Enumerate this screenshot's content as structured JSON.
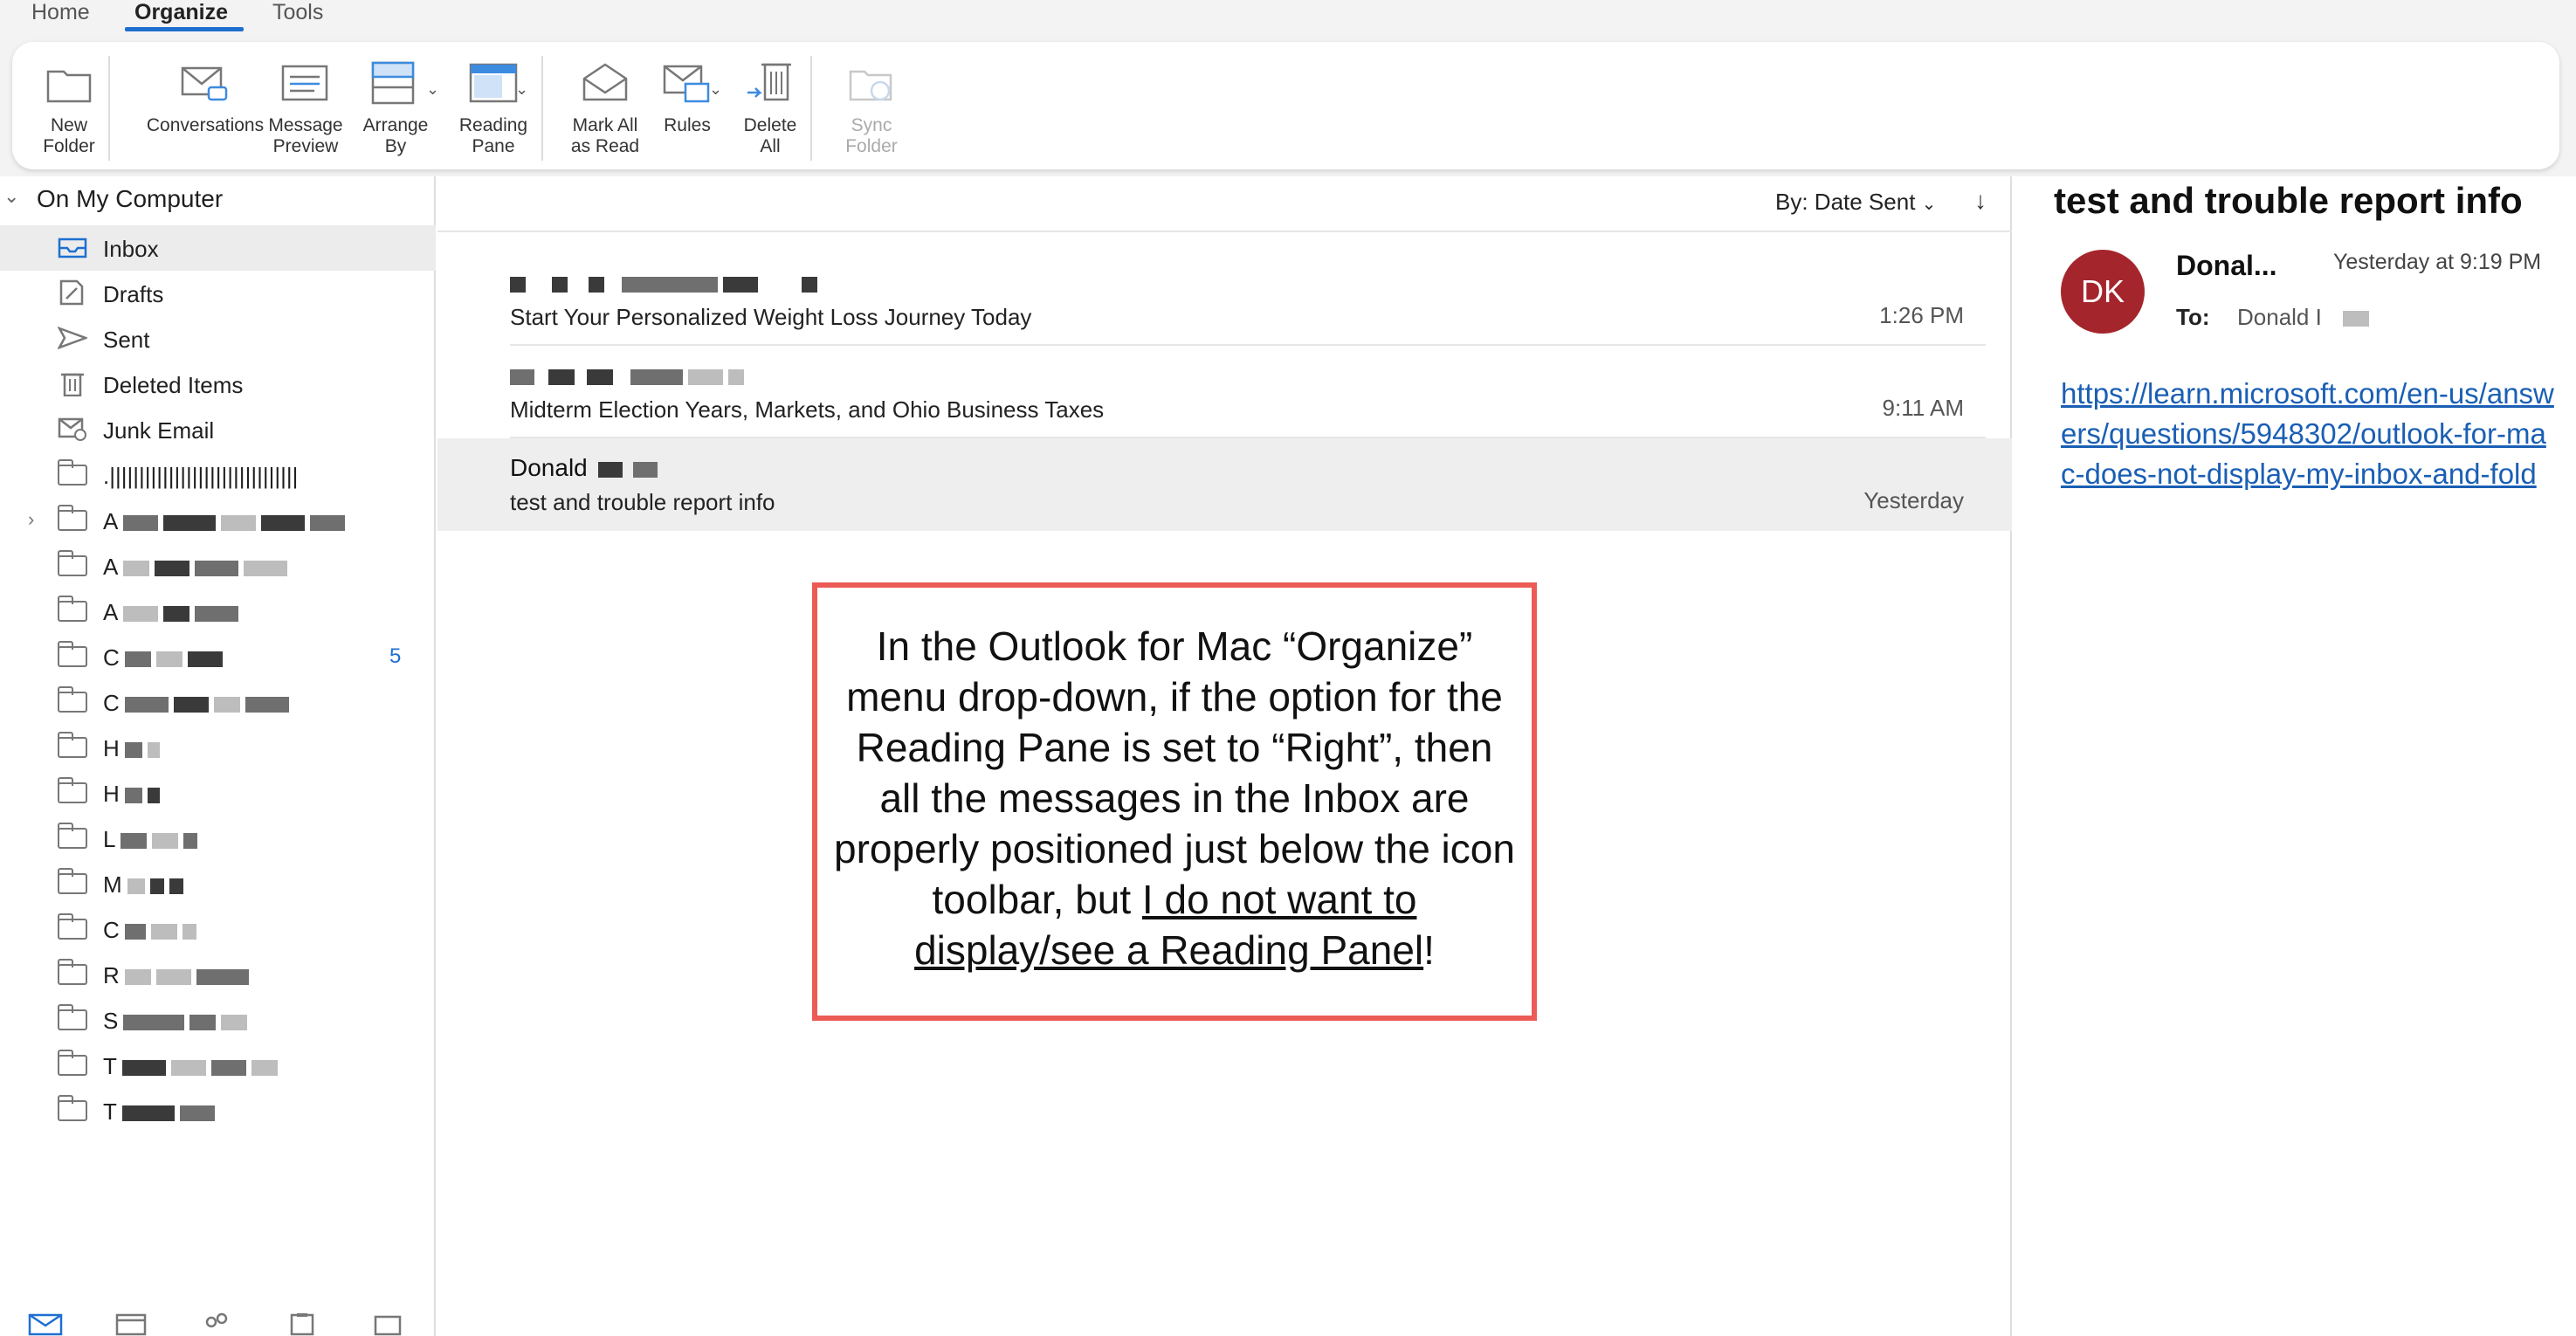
{
  "tabs": [
    {
      "label": "Home"
    },
    {
      "label": "Organize",
      "active": true
    },
    {
      "label": "Tools"
    }
  ],
  "ribbon": {
    "new_folder": "New\nFolder",
    "conversations": "Conversations",
    "message_preview": "Message\nPreview",
    "arrange_by": "Arrange\nBy",
    "reading_pane": "Reading\nPane",
    "mark_all_read": "Mark All\nas Read",
    "rules": "Rules",
    "delete_all": "Delete\nAll",
    "sync_folder": "Sync\nFolder"
  },
  "sidebar": {
    "account": "On My Computer",
    "folders": [
      {
        "label": "Inbox",
        "icon": "inbox-icon"
      },
      {
        "label": "Drafts",
        "icon": "drafts-icon"
      },
      {
        "label": "Sent",
        "icon": "sent-icon"
      },
      {
        "label": "Deleted Items",
        "icon": "trash-icon"
      },
      {
        "label": "Junk Email",
        "icon": "junk-icon"
      },
      {
        "label": ".||||||||||||||||||||||||||||||||",
        "icon": "folder-icon"
      },
      {
        "label": "A",
        "icon": "folder-icon"
      },
      {
        "label": "A",
        "icon": "folder-icon"
      },
      {
        "label": "A",
        "icon": "folder-icon"
      },
      {
        "label": "C",
        "icon": "folder-icon",
        "badge": "5"
      },
      {
        "label": "C",
        "icon": "folder-icon"
      },
      {
        "label": "H",
        "icon": "folder-icon"
      },
      {
        "label": "H",
        "icon": "folder-icon"
      },
      {
        "label": "L",
        "icon": "folder-icon"
      },
      {
        "label": "M",
        "icon": "folder-icon"
      },
      {
        "label": "C",
        "icon": "folder-icon"
      },
      {
        "label": "R",
        "icon": "folder-icon"
      },
      {
        "label": "S",
        "icon": "folder-icon"
      },
      {
        "label": "T",
        "icon": "folder-icon"
      },
      {
        "label": "T",
        "icon": "folder-icon"
      }
    ]
  },
  "list": {
    "sort_label": "By: Date Sent",
    "sort_arrow": "↓",
    "messages": [
      {
        "sender": "",
        "subject": "Start Your Personalized Weight Loss Journey Today",
        "time": "1:26 PM"
      },
      {
        "sender": "",
        "subject": "Midterm Election Years, Markets, and Ohio Business Taxes",
        "time": "9:11 AM"
      },
      {
        "sender": "Donald",
        "subject": "test and trouble report info",
        "time": "Yesterday"
      }
    ]
  },
  "callout": {
    "line1": "In the Outlook for Mac “Organize” menu drop-down, if the option for the Reading Pane is set to “Right”, then all the messages in the Inbox are properly positioned just below the icon toolbar, but ",
    "underlined": "I do not want to display/see a Reading Panel",
    "end": "!"
  },
  "reading": {
    "title": "test and trouble report info",
    "avatar_initials": "DK",
    "sender": "Donal...",
    "time": "Yesterday at 9:19 PM",
    "to_label": "To:",
    "to_name": "Donald I",
    "link": "https://learn.microsoft.com/en-us/answers/questions/5948302/outlook-for-mac-does-not-display-my-inbox-and-fold"
  },
  "colors": {
    "accent": "#1e6fd0",
    "avatar": "#a4262c",
    "callout_border": "#ec5b55",
    "link": "#1a5fb4"
  }
}
